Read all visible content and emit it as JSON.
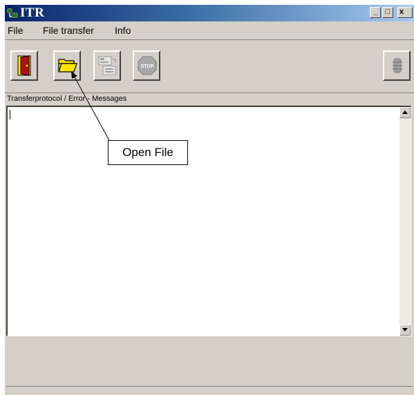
{
  "window": {
    "title": "ITR",
    "icon": "app-network-icon",
    "caption_buttons": {
      "minimize": "_",
      "maximize": "□",
      "close": "x"
    }
  },
  "menu": {
    "items": [
      {
        "label": "File"
      },
      {
        "label": "File transfer"
      },
      {
        "label": "Info"
      }
    ]
  },
  "toolbar": {
    "buttons": [
      {
        "name": "exit",
        "icon": "door-exit-icon"
      },
      {
        "name": "open",
        "icon": "folder-open-icon"
      },
      {
        "name": "transfer",
        "icon": "file-transfer-icon"
      },
      {
        "name": "stop",
        "icon": "stop-sign-icon",
        "icon_text": "STOP"
      },
      {
        "name": "connection",
        "icon": "connection-icon"
      }
    ]
  },
  "messages": {
    "label": "Transferprotocol / Error - Messages",
    "content": ""
  },
  "annotation": {
    "callout_text": "Open File"
  },
  "colors": {
    "titlebar_start": "#0a246a",
    "titlebar_end": "#a6caf0",
    "window_face": "#d4d0c8"
  }
}
